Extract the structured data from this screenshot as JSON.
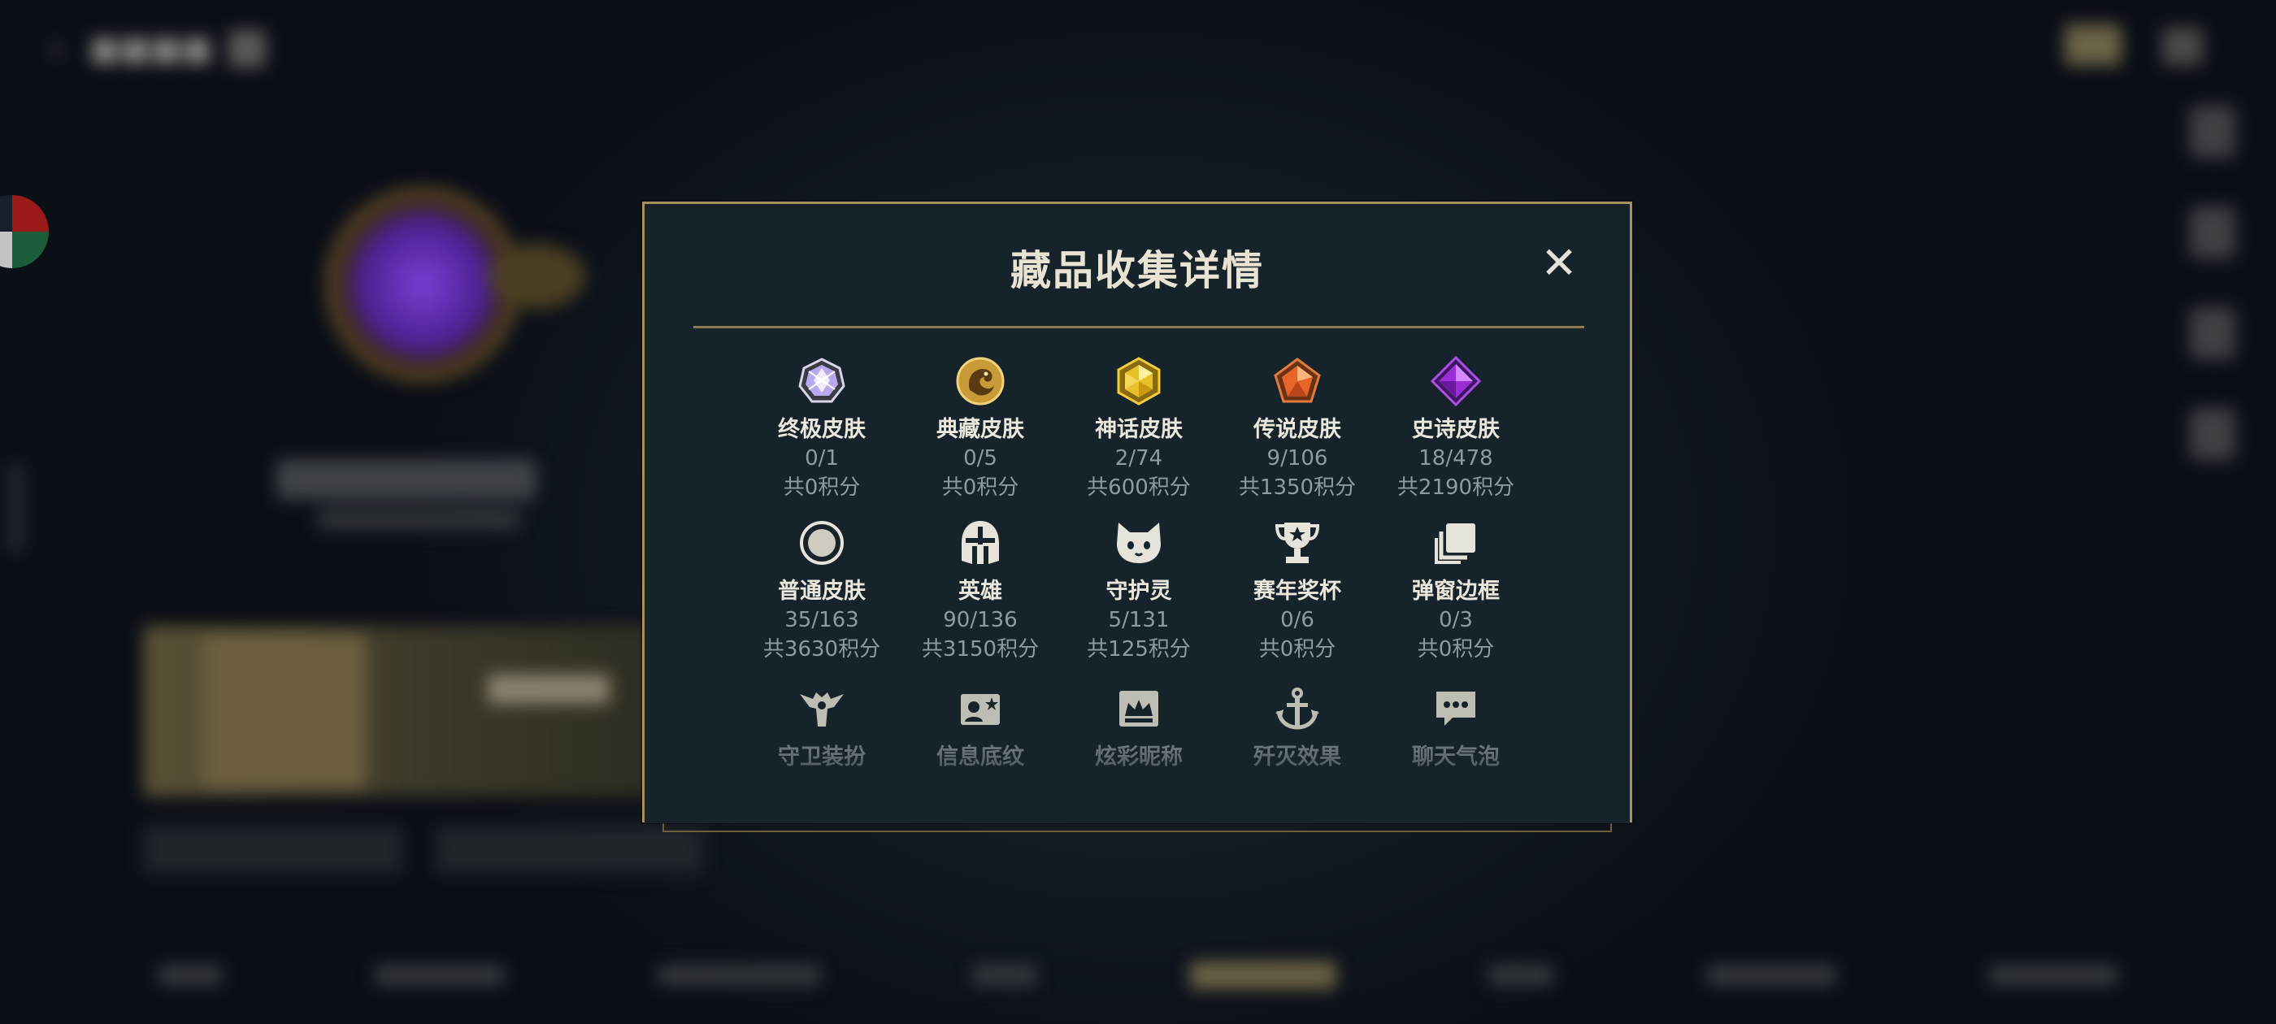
{
  "modal": {
    "title": "藏品收集详情",
    "close_label": "✕"
  },
  "categories": [
    {
      "name": "终极皮肤",
      "count": "0/1",
      "points": "共0积分",
      "icon": "ultimate-skin-gem-icon"
    },
    {
      "name": "典藏皮肤",
      "count": "0/5",
      "points": "共0积分",
      "icon": "prestige-skin-dragon-icon"
    },
    {
      "name": "神话皮肤",
      "count": "2/74",
      "points": "共600积分",
      "icon": "mythic-skin-gem-icon"
    },
    {
      "name": "传说皮肤",
      "count": "9/106",
      "points": "共1350积分",
      "icon": "legendary-skin-gem-icon"
    },
    {
      "name": "史诗皮肤",
      "count": "18/478",
      "points": "共2190积分",
      "icon": "epic-skin-gem-icon"
    },
    {
      "name": "普通皮肤",
      "count": "35/163",
      "points": "共3630积分",
      "icon": "normal-skin-circle-icon"
    },
    {
      "name": "英雄",
      "count": "90/136",
      "points": "共3150积分",
      "icon": "hero-helmet-icon"
    },
    {
      "name": "守护灵",
      "count": "5/131",
      "points": "共125积分",
      "icon": "guardian-cat-icon"
    },
    {
      "name": "赛年奖杯",
      "count": "0/6",
      "points": "共0积分",
      "icon": "trophy-icon"
    },
    {
      "name": "弹窗边框",
      "count": "0/3",
      "points": "共0积分",
      "icon": "popup-frame-icon"
    },
    {
      "name": "守卫装扮",
      "icon": "ward-skin-icon"
    },
    {
      "name": "信息底纹",
      "icon": "info-background-icon"
    },
    {
      "name": "炫彩昵称",
      "icon": "colorful-nickname-icon"
    },
    {
      "name": "歼灭效果",
      "icon": "annihilation-effect-icon"
    },
    {
      "name": "聊天气泡",
      "icon": "chat-bubble-icon"
    }
  ],
  "colors": {
    "accent_gold": "#a8915a",
    "modal_bg": "#16232a",
    "text_primary": "#eae7dc",
    "text_secondary": "#8f9aa3"
  }
}
